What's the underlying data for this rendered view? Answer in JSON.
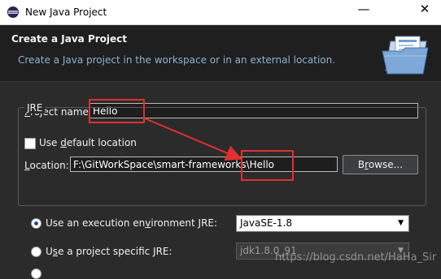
{
  "window": {
    "title": "New Java Project",
    "minimize_glyph": "—",
    "close_glyph": "✕"
  },
  "banner": {
    "heading": "Create a Java Project",
    "description": "Create a Java project in the workspace or in an external location."
  },
  "form": {
    "project_name_label_u": "P",
    "project_name_label_rest": "roject name:",
    "project_name_value": "Hello",
    "use_default_pre": "Use ",
    "use_default_u": "d",
    "use_default_rest": "efault location",
    "use_default_checked": false,
    "location_label_u": "L",
    "location_label_rest": "ocation:",
    "location_value_path": "F:\\GitWorkSpace\\smart-frameworks",
    "location_value_tail": "\\Hello",
    "browse_label_u": "r",
    "browse_label_pre": "B",
    "browse_label_rest": "owse..."
  },
  "jre": {
    "group_title": "JRE",
    "opt1_pre": "Use an execution en",
    "opt1_u": "v",
    "opt1_rest": "ironment JRE:",
    "opt1_value": "JavaSE-1.8",
    "opt1_selected": true,
    "opt2_pre": "U",
    "opt2_u": "s",
    "opt2_rest": "e a project specific JRE:",
    "opt2_value": "jdk1.8.0_91",
    "opt2_selected": false
  },
  "watermark": "https://blog.csdn.net/HaHa_Sir",
  "colors": {
    "highlight": "#e03030",
    "select_active_bg": "#ffffff",
    "select_disabled_bg": "#3c3c3c"
  }
}
